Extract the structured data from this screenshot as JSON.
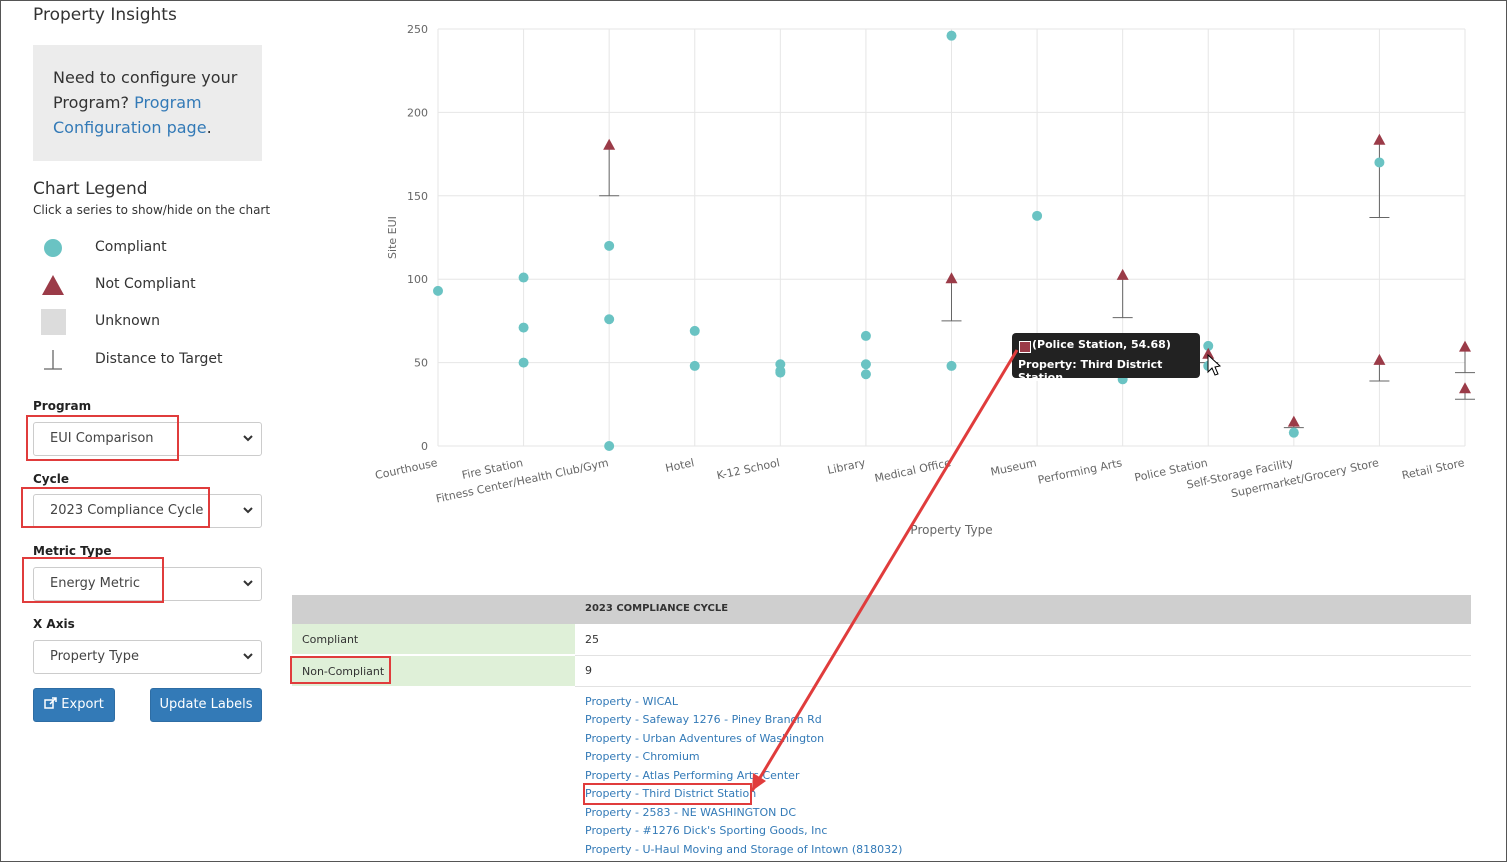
{
  "page": {
    "title": "Property Insights"
  },
  "config_notice": {
    "text": "Need to configure your Program?",
    "link": "Program Configuration page",
    "suffix": "."
  },
  "legend": {
    "title": "Chart Legend",
    "subtitle": "Click a series to show/hide on the chart",
    "items": [
      {
        "label": "Compliant",
        "icon": "circle-icon",
        "color": "#6ac3c3"
      },
      {
        "label": "Not Compliant",
        "icon": "triangle-icon",
        "color": "#9b3b48"
      },
      {
        "label": "Unknown",
        "icon": "square-icon",
        "color": "#dcdcdc"
      },
      {
        "label": "Distance to Target",
        "icon": "target-line-icon",
        "color": "#666666"
      }
    ]
  },
  "filters": {
    "program": {
      "label": "Program",
      "value": "EUI Comparison"
    },
    "cycle": {
      "label": "Cycle",
      "value": "2023 Compliance Cycle"
    },
    "metric_type": {
      "label": "Metric Type",
      "value": "Energy Metric"
    },
    "x_axis": {
      "label": "X Axis",
      "value": "Property Type"
    }
  },
  "buttons": {
    "export": "Export",
    "update_labels": "Update Labels"
  },
  "tooltip": {
    "line1": "(Police Station, 54.68)",
    "line2": "Property: Third District Station"
  },
  "table": {
    "header": "2023 COMPLIANCE CYCLE",
    "rows": [
      {
        "label": "Compliant",
        "value": "25"
      },
      {
        "label": "Non-Compliant",
        "value": "9"
      }
    ],
    "properties": [
      "Property - WICAL",
      "Property - Safeway 1276 - Piney Branch Rd",
      "Property - Urban Adventures of Washington",
      "Property - Chromium",
      "Property - Atlas Performing Arts Center",
      "Property - Third District Station",
      "Property - 2583 - NE WASHINGTON DC",
      "Property - #1276 Dick's Sporting Goods, Inc",
      "Property - U-Haul Moving and Storage of Intown (818032)"
    ]
  },
  "chart_data": {
    "type": "scatter",
    "xlabel": "Property Type",
    "ylabel": "Site EUI",
    "ylim": [
      0,
      250
    ],
    "yticks": [
      0,
      50,
      100,
      150,
      200,
      250
    ],
    "grid": true,
    "categories": [
      "Courthouse",
      "Fire Station",
      "Fitness Center/Health Club/Gym",
      "Hotel",
      "K-12 School",
      "Library",
      "Medical Office",
      "Museum",
      "Performing Arts",
      "Police Station",
      "Self-Storage Facility",
      "Supermarket/Grocery Store",
      "Retail Store"
    ],
    "series": [
      {
        "name": "Compliant",
        "color": "#6ac3c3",
        "points": [
          {
            "x": "Courthouse",
            "y": 93
          },
          {
            "x": "Fire Station",
            "y": 101
          },
          {
            "x": "Fire Station",
            "y": 71
          },
          {
            "x": "Fire Station",
            "y": 50
          },
          {
            "x": "Fitness Center/Health Club/Gym",
            "y": 120
          },
          {
            "x": "Fitness Center/Health Club/Gym",
            "y": 76
          },
          {
            "x": "Fitness Center/Health Club/Gym",
            "y": 0
          },
          {
            "x": "Hotel",
            "y": 69
          },
          {
            "x": "Hotel",
            "y": 48
          },
          {
            "x": "K-12 School",
            "y": 49
          },
          {
            "x": "K-12 School",
            "y": 45
          },
          {
            "x": "K-12 School",
            "y": 44
          },
          {
            "x": "Library",
            "y": 66
          },
          {
            "x": "Library",
            "y": 49
          },
          {
            "x": "Library",
            "y": 43
          },
          {
            "x": "Medical Office",
            "y": 246
          },
          {
            "x": "Medical Office",
            "y": 48
          },
          {
            "x": "Museum",
            "y": 138
          },
          {
            "x": "Performing Arts",
            "y": 40
          },
          {
            "x": "Police Station",
            "y": 60
          },
          {
            "x": "Police Station",
            "y": 48
          },
          {
            "x": "Self-Storage Facility",
            "y": 8
          },
          {
            "x": "Supermarket/Grocery Store",
            "y": 170
          }
        ]
      },
      {
        "name": "Not Compliant",
        "color": "#9b3b48",
        "points": [
          {
            "x": "Fitness Center/Health Club/Gym",
            "y": 180,
            "target": 150
          },
          {
            "x": "Medical Office",
            "y": 100,
            "target": 75
          },
          {
            "x": "Performing Arts",
            "y": 102,
            "target": 77
          },
          {
            "x": "Police Station",
            "y": 54.68,
            "target": 50
          },
          {
            "x": "Self-Storage Facility",
            "y": 14,
            "target": 11
          },
          {
            "x": "Supermarket/Grocery Store",
            "y": 183,
            "target": 137
          },
          {
            "x": "Supermarket/Grocery Store",
            "y": 51,
            "target": 39
          },
          {
            "x": "Retail Store",
            "y": 59,
            "target": 44
          },
          {
            "x": "Retail Store",
            "y": 34,
            "target": 28
          }
        ]
      }
    ]
  }
}
